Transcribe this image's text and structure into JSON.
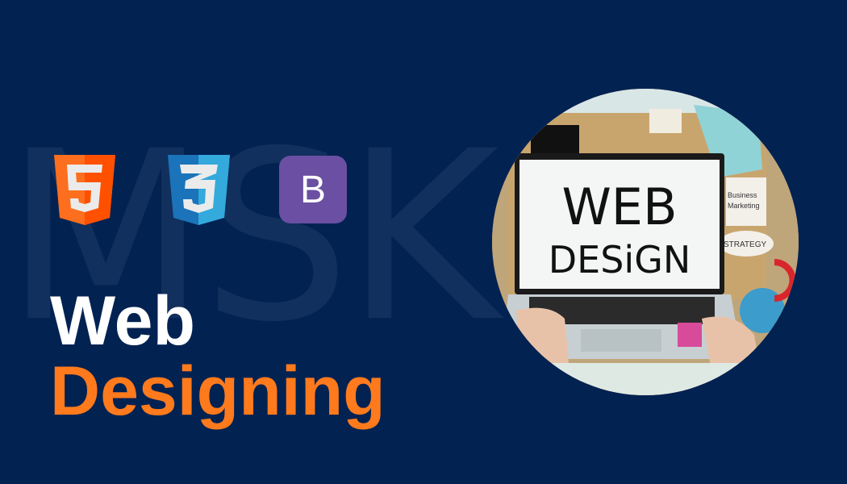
{
  "watermark": "MSK",
  "logos": {
    "html5": "5",
    "css3": "3",
    "bootstrap": "B"
  },
  "title": {
    "line1": "Web",
    "line2": "Designing"
  },
  "photo": {
    "screen_line1": "WEB",
    "screen_line2": "DESiGN",
    "note_strategy": "STRATEGY",
    "note_business": "Business",
    "note_marketing": "Marketing"
  },
  "colors": {
    "background": "#022252",
    "accent": "#ff7a1c",
    "html5": "#f16524",
    "css3": "#2a7ac0",
    "bootstrap": "#6a4fa3"
  }
}
